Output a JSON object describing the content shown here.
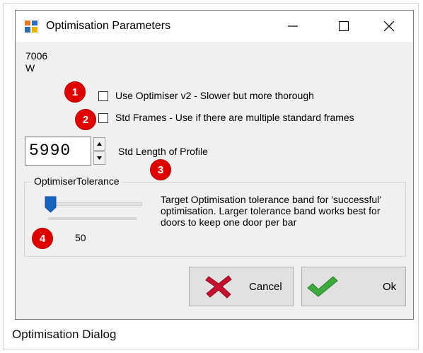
{
  "window": {
    "title": "Optimisation Parameters",
    "code_line1": "7006",
    "code_line2": "W"
  },
  "title_buttons": {
    "minimize_glyph": "—",
    "maximize_glyph": "☐",
    "close_glyph": "✕"
  },
  "options": {
    "optimiser_v2": {
      "label": "Use Optimiser v2 - Slower but more thorough",
      "checked": false
    },
    "std_frames": {
      "label": "Std Frames - Use if there are multiple standard frames",
      "checked": false
    }
  },
  "std_length": {
    "value": "5990",
    "label": "Std Length of Profile"
  },
  "tolerance": {
    "group_title": "OptimiserTolerance",
    "value": "50",
    "description": "Target Optimisation tolerance band for 'successful' optimisation. Larger tolerance band works best for doors to keep one door per bar"
  },
  "badges": [
    "1",
    "2",
    "3",
    "4"
  ],
  "buttons": {
    "cancel_label": "Cancel",
    "ok_label": "Ok"
  },
  "caption": "Optimisation Dialog",
  "colors": {
    "badge": "#e00000",
    "cancel_icon": "#c8102e",
    "ok_icon": "#3caa3c",
    "slider_thumb": "#1565c0"
  },
  "icons": {
    "app": "app-grid-icon",
    "cancel": "red-x-icon",
    "ok": "green-check-icon"
  }
}
